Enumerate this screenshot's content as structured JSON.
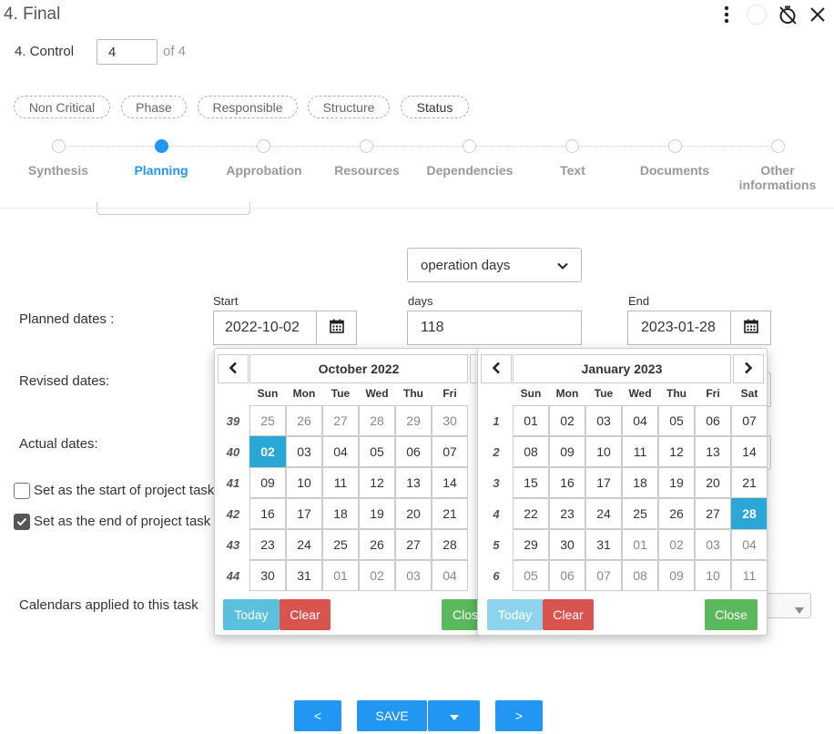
{
  "header": {
    "title": "4. Final",
    "control_label": "4. Control",
    "control_value": "4",
    "control_of": "of 4"
  },
  "chips": [
    "Non Critical",
    "Phase",
    "Responsible",
    "Structure",
    "Status"
  ],
  "steps": [
    "Synthesis",
    "Planning",
    "Approbation",
    "Resources",
    "Dependencies",
    "Text",
    "Documents",
    "Other informations"
  ],
  "active_step": "Planning",
  "form": {
    "days_mode": "operation days",
    "start_label": "Start",
    "days_label": "days",
    "end_label": "End",
    "planned_label": "Planned dates :",
    "revised_label": "Revised dates:",
    "actual_label": "Actual dates:",
    "planned_start": "2022-10-02",
    "planned_days": "118",
    "planned_end": "2023-01-28",
    "set_start_label": "Set as the start of project task",
    "set_start_checked": false,
    "set_end_label": "Set as the end of project task",
    "set_end_checked": true,
    "calendars_label": "Calendars applied to this task"
  },
  "datepicker_left": {
    "title": "October 2022",
    "dow": [
      "Sun",
      "Mon",
      "Tue",
      "Wed",
      "Thu",
      "Fri"
    ],
    "weeks": [
      {
        "wk": "39",
        "days": [
          {
            "d": "25",
            "o": true
          },
          {
            "d": "26",
            "o": true
          },
          {
            "d": "27",
            "o": true
          },
          {
            "d": "28",
            "o": true
          },
          {
            "d": "29",
            "o": true
          },
          {
            "d": "30",
            "o": true
          }
        ]
      },
      {
        "wk": "40",
        "days": [
          {
            "d": "02",
            "s": true
          },
          {
            "d": "03"
          },
          {
            "d": "04"
          },
          {
            "d": "05"
          },
          {
            "d": "06"
          },
          {
            "d": "07"
          }
        ]
      },
      {
        "wk": "41",
        "days": [
          {
            "d": "09"
          },
          {
            "d": "10"
          },
          {
            "d": "11"
          },
          {
            "d": "12"
          },
          {
            "d": "13"
          },
          {
            "d": "14"
          }
        ]
      },
      {
        "wk": "42",
        "days": [
          {
            "d": "16"
          },
          {
            "d": "17"
          },
          {
            "d": "18"
          },
          {
            "d": "19"
          },
          {
            "d": "20"
          },
          {
            "d": "21"
          }
        ]
      },
      {
        "wk": "43",
        "days": [
          {
            "d": "23"
          },
          {
            "d": "24"
          },
          {
            "d": "25"
          },
          {
            "d": "26"
          },
          {
            "d": "27"
          },
          {
            "d": "28"
          }
        ]
      },
      {
        "wk": "44",
        "days": [
          {
            "d": "30"
          },
          {
            "d": "31"
          },
          {
            "d": "01",
            "o": true
          },
          {
            "d": "02",
            "o": true
          },
          {
            "d": "03",
            "o": true
          },
          {
            "d": "04",
            "o": true
          }
        ]
      }
    ],
    "today": "Today",
    "clear": "Clear",
    "close": "Close"
  },
  "datepicker_right": {
    "title": "January 2023",
    "dow": [
      "Sun",
      "Mon",
      "Tue",
      "Wed",
      "Thu",
      "Fri",
      "Sat"
    ],
    "weeks": [
      {
        "wk": "1",
        "days": [
          {
            "d": "01"
          },
          {
            "d": "02"
          },
          {
            "d": "03"
          },
          {
            "d": "04"
          },
          {
            "d": "05"
          },
          {
            "d": "06"
          },
          {
            "d": "07"
          }
        ]
      },
      {
        "wk": "2",
        "days": [
          {
            "d": "08"
          },
          {
            "d": "09"
          },
          {
            "d": "10"
          },
          {
            "d": "11"
          },
          {
            "d": "12"
          },
          {
            "d": "13"
          },
          {
            "d": "14"
          }
        ]
      },
      {
        "wk": "3",
        "days": [
          {
            "d": "15"
          },
          {
            "d": "16"
          },
          {
            "d": "17"
          },
          {
            "d": "18"
          },
          {
            "d": "19"
          },
          {
            "d": "20"
          },
          {
            "d": "21"
          }
        ]
      },
      {
        "wk": "4",
        "days": [
          {
            "d": "22"
          },
          {
            "d": "23"
          },
          {
            "d": "24"
          },
          {
            "d": "25"
          },
          {
            "d": "26"
          },
          {
            "d": "27"
          },
          {
            "d": "28",
            "s": true
          }
        ]
      },
      {
        "wk": "5",
        "days": [
          {
            "d": "29"
          },
          {
            "d": "30"
          },
          {
            "d": "31"
          },
          {
            "d": "01",
            "o": true
          },
          {
            "d": "02",
            "o": true
          },
          {
            "d": "03",
            "o": true
          },
          {
            "d": "04",
            "o": true
          }
        ]
      },
      {
        "wk": "6",
        "days": [
          {
            "d": "05",
            "o": true
          },
          {
            "d": "06",
            "o": true
          },
          {
            "d": "07",
            "o": true
          },
          {
            "d": "08",
            "o": true
          },
          {
            "d": "09",
            "o": true
          },
          {
            "d": "10",
            "o": true
          },
          {
            "d": "11",
            "o": true
          }
        ]
      }
    ],
    "today": "Today",
    "clear": "Clear",
    "close": "Close"
  },
  "bottom": {
    "prev": "<",
    "save": "SAVE",
    "next": ">"
  },
  "colors": {
    "primary": "#2196f3",
    "selected_day": "#29a8d8",
    "today_btn": "#5bc0de",
    "clear_btn": "#d9534f",
    "close_btn": "#5cb85c"
  },
  "icons": [
    "more-vert-icon",
    "circle-icon",
    "timer-off-icon",
    "close-icon",
    "calendar-icon",
    "chevron-left-icon",
    "chevron-right-icon",
    "caret-down-icon",
    "check-icon"
  ]
}
